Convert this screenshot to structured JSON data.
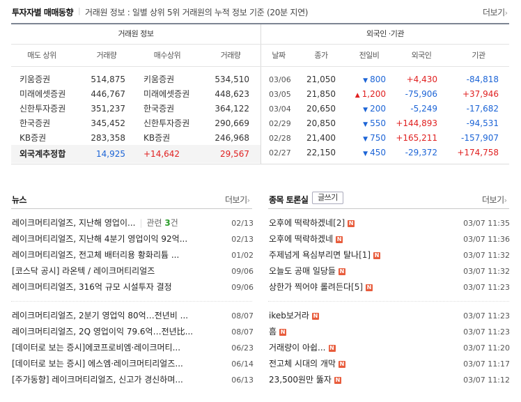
{
  "investor": {
    "title": "투자자별 매매동향",
    "separator": "|",
    "description": "거래원 정보 : 일별 상위 5위 거래원의 누적 정보 기준 (20분 지연)",
    "more": "더보기",
    "broker_header": "거래원 정보",
    "foreign_header": "외국인 ·기관",
    "broker_cols": [
      "매도 상위",
      "거래량",
      "매수상위",
      "거래량"
    ],
    "foreign_cols": [
      "날짜",
      "종가",
      "전일비",
      "외국인",
      "기관"
    ],
    "broker_rows": [
      {
        "sell": "키움증권",
        "sell_vol": "514,875",
        "buy": "키움증권",
        "buy_vol": "534,510"
      },
      {
        "sell": "미래에셋증권",
        "sell_vol": "446,767",
        "buy": "미래에셋증권",
        "buy_vol": "448,623"
      },
      {
        "sell": "신한투자증권",
        "sell_vol": "351,237",
        "buy": "한국증권",
        "buy_vol": "364,122"
      },
      {
        "sell": "한국증권",
        "sell_vol": "345,452",
        "buy": "신한투자증권",
        "buy_vol": "290,669"
      },
      {
        "sell": "KB증권",
        "sell_vol": "283,358",
        "buy": "KB증권",
        "buy_vol": "246,968"
      }
    ],
    "foreign_estimate": {
      "label": "외국계추정합",
      "sell_vol": "14,925",
      "diff": "+14,642",
      "buy_vol": "29,567"
    },
    "foreign_rows": [
      {
        "date": "03/06",
        "close": "21,050",
        "dir": "down",
        "arrow": "▼",
        "change": "800",
        "foreign": "+4,430",
        "inst": "-84,818"
      },
      {
        "date": "03/05",
        "close": "21,850",
        "dir": "up",
        "arrow": "▲",
        "change": "1,200",
        "foreign": "-75,906",
        "inst": "+37,946"
      },
      {
        "date": "03/04",
        "close": "20,650",
        "dir": "down",
        "arrow": "▼",
        "change": "200",
        "foreign": "-5,249",
        "inst": "-17,682"
      },
      {
        "date": "02/29",
        "close": "20,850",
        "dir": "down",
        "arrow": "▼",
        "change": "550",
        "foreign": "+144,893",
        "inst": "-94,531"
      },
      {
        "date": "02/28",
        "close": "21,400",
        "dir": "down",
        "arrow": "▼",
        "change": "750",
        "foreign": "+165,211",
        "inst": "-157,907"
      },
      {
        "date": "02/27",
        "close": "22,150",
        "dir": "down",
        "arrow": "▼",
        "change": "450",
        "foreign": "-29,372",
        "inst": "+174,758"
      }
    ]
  },
  "news": {
    "title": "뉴스",
    "more": "더보기",
    "items": [
      {
        "title": "레이크머티리얼즈, 지난해 영업이...",
        "related_prefix": "관련 ",
        "related_count": "3",
        "related_suffix": "건",
        "date": "02/13"
      },
      {
        "title": "레이크머티리얼즈, 지난해 4분기 영업이익 92억...",
        "date": "02/13"
      },
      {
        "title": "레이크머티리얼즈, 전고체 배터리용 황화리튬 ...",
        "date": "01/02"
      },
      {
        "title": "[코스닥 공시] 라온텍 / 레이크머티리얼즈",
        "date": "09/06"
      },
      {
        "title": "레이크머티리얼즈, 316억 규모 시설투자 결정",
        "date": "09/06"
      },
      {
        "title": "레이크머티리얼즈, 2분기 영업익 80억…전년비 ...",
        "date": "08/07"
      },
      {
        "title": "레이크머티리얼즈, 2Q 영업이익 79.6억…전년比...",
        "date": "08/07"
      },
      {
        "title": "[데이터로 보는 증시]에코프로비엠·레이크머티...",
        "date": "06/23"
      },
      {
        "title": "[데이터로 보는 증시] 에스엠·레이크머티리얼즈...",
        "date": "06/14"
      },
      {
        "title": "[주가동향] 레이크머티리얼즈, 신고가 경신하며...",
        "date": "06/13"
      }
    ]
  },
  "board": {
    "title": "종목 토론실",
    "write": "글쓰기",
    "more": "더보기",
    "new_badge": "N",
    "items": [
      {
        "title": "오후에 떡락하겠네",
        "comments": "[2]",
        "datetime": "03/07 11:35"
      },
      {
        "title": "오후에 떡락하겠네",
        "comments": "",
        "datetime": "03/07 11:36"
      },
      {
        "title": "주제넘게 욕심부리면 탈나",
        "comments": "[1]",
        "datetime": "03/07 11:32"
      },
      {
        "title": "오늘도 공매 일당들",
        "comments": "",
        "datetime": "03/07 11:32"
      },
      {
        "title": "상한가 찍어야 롤려든다",
        "comments": "[5]",
        "datetime": "03/07 11:23"
      },
      {
        "title": "ikeb보거라",
        "comments": "",
        "datetime": "03/07 11:23"
      },
      {
        "title": "흠",
        "comments": "",
        "datetime": "03/07 11:23"
      },
      {
        "title": "거래량이 아쉽...",
        "comments": "",
        "datetime": "03/07 11:20"
      },
      {
        "title": "전고체 시대의 개막",
        "comments": "",
        "datetime": "03/07 11:17"
      },
      {
        "title": "23,500원만 뚫자",
        "comments": "",
        "datetime": "03/07 11:12"
      }
    ]
  },
  "colors": {
    "up": "#e02020",
    "down": "#1c64d6",
    "badge": "#e85c3c"
  },
  "icons": {
    "more": "chevron-right-icon",
    "new": "new-badge-icon"
  }
}
